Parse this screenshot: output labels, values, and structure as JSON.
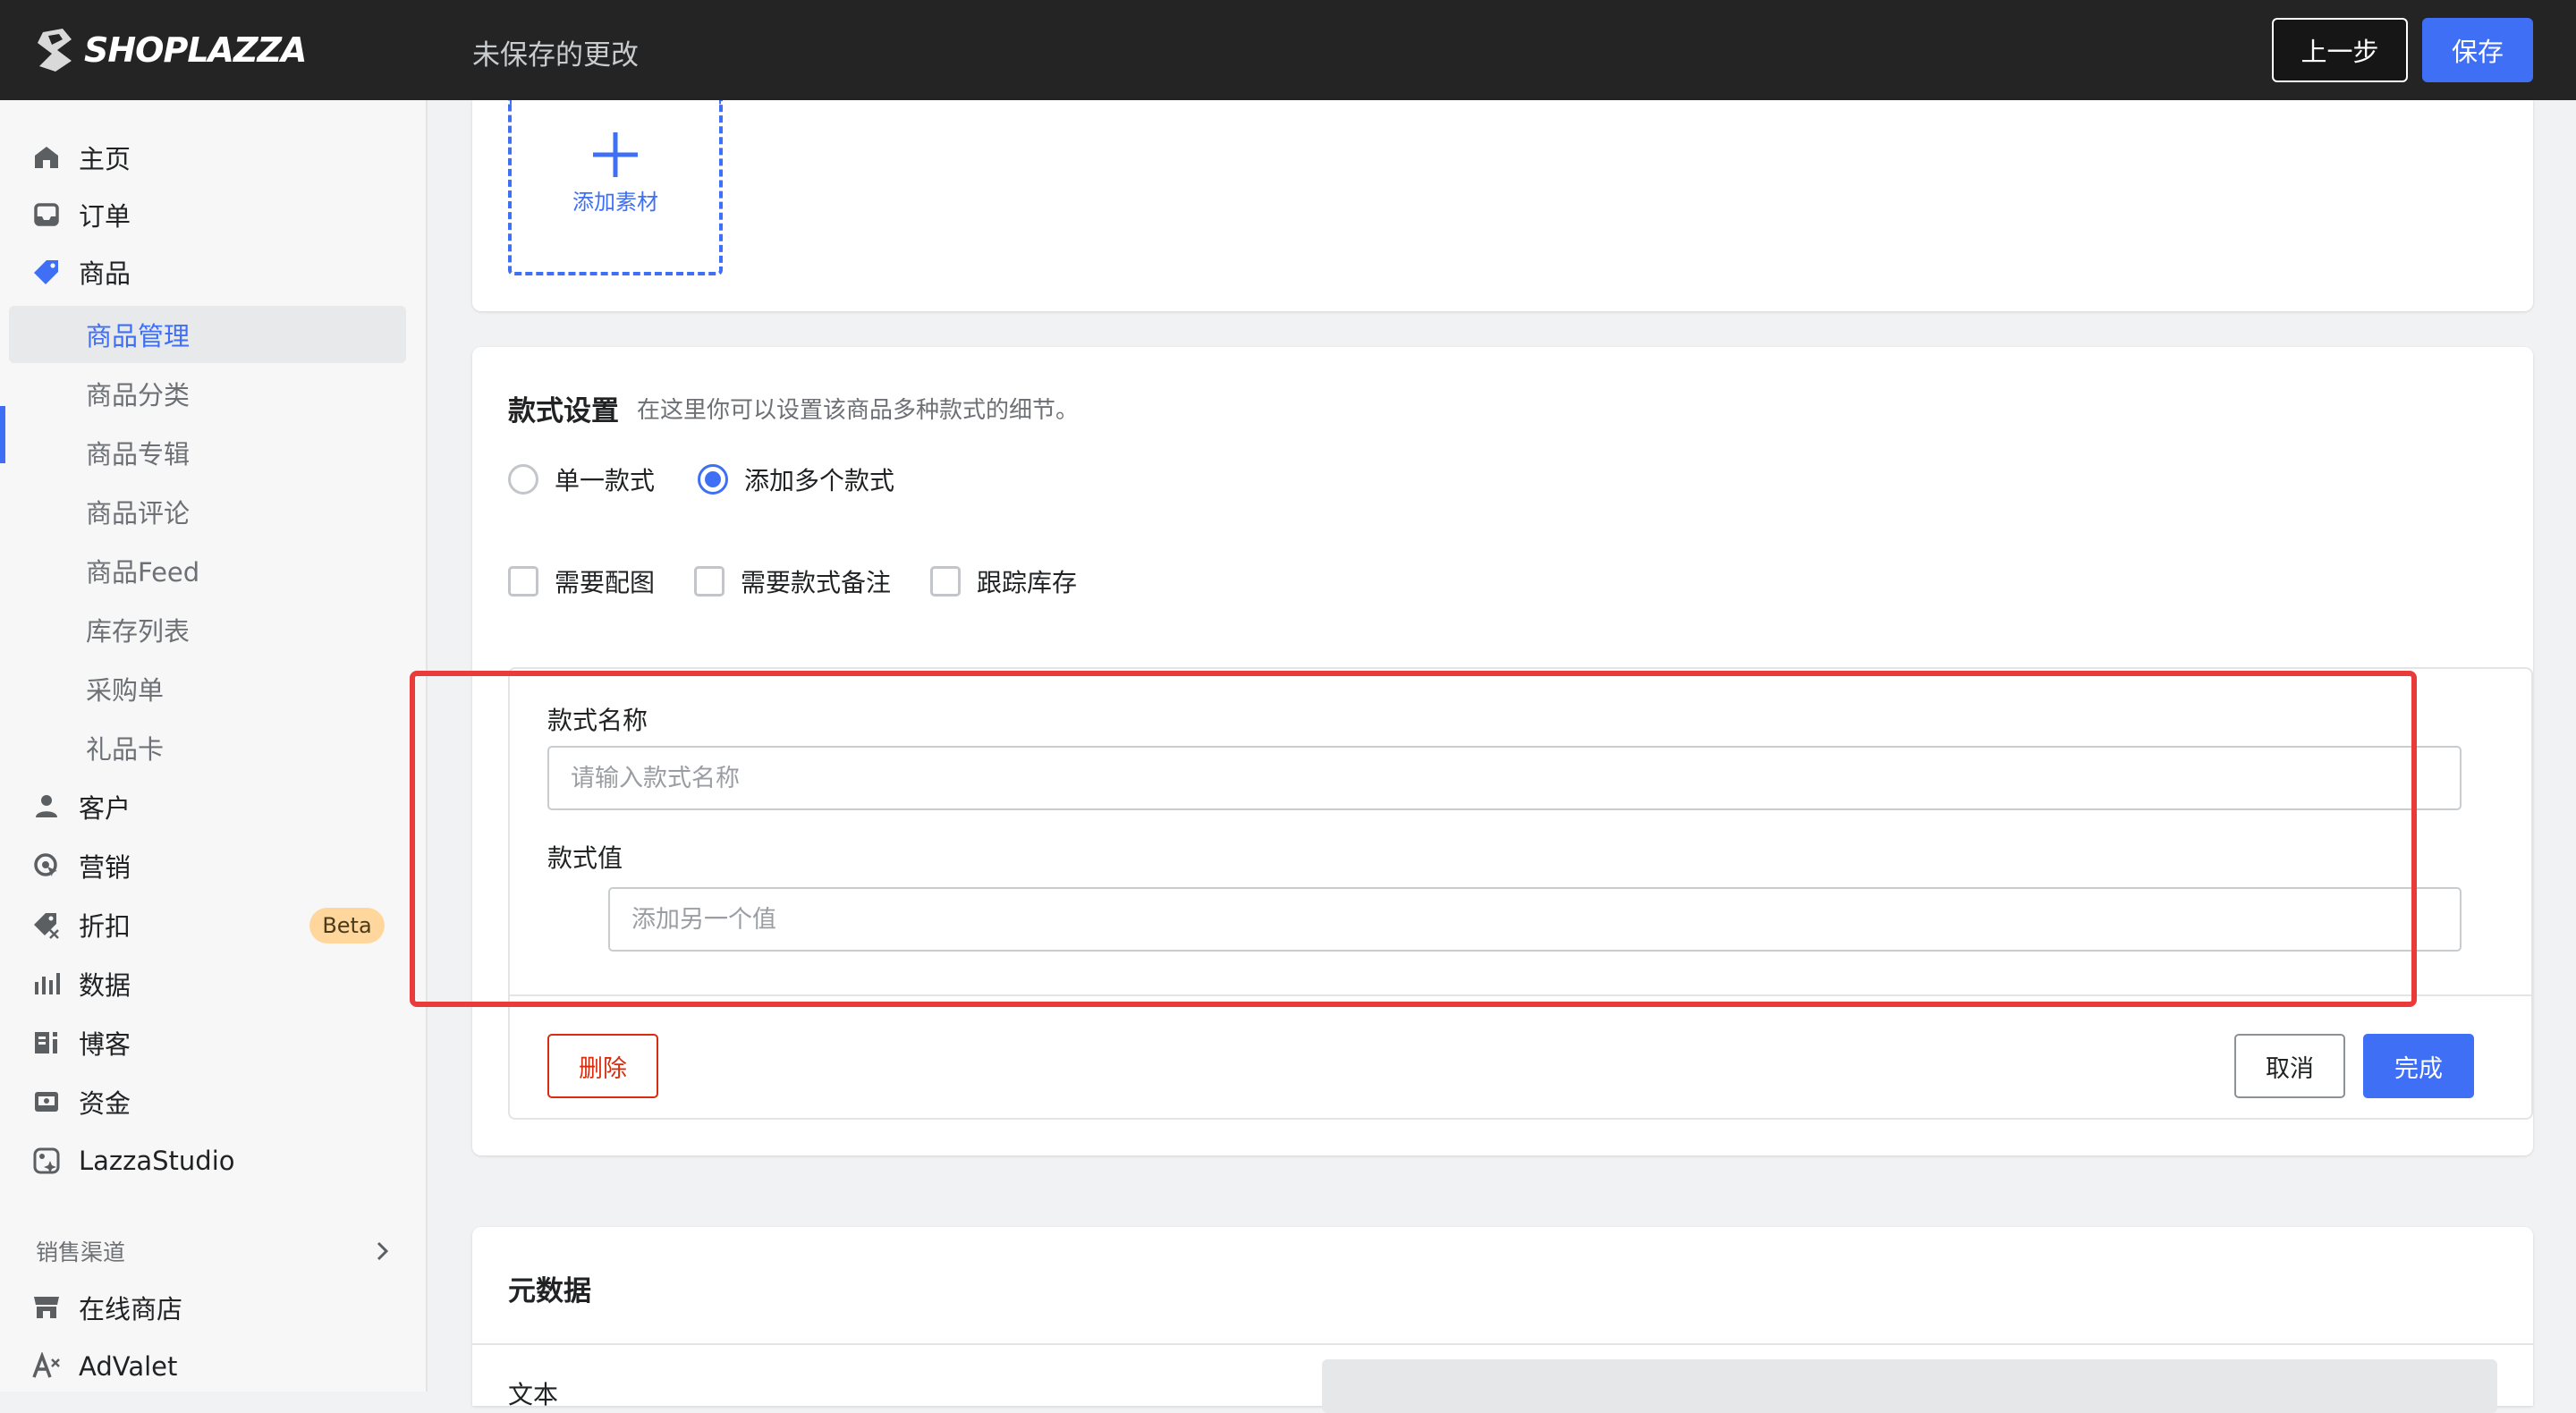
{
  "topbar": {
    "brand": "SHOPLAZZA",
    "status": "未保存的更改",
    "prev_label": "上一步",
    "save_label": "保存"
  },
  "sidebar": {
    "items": [
      {
        "label": "主页",
        "icon": "home-icon"
      },
      {
        "label": "订单",
        "icon": "inbox-icon"
      },
      {
        "label": "商品",
        "icon": "tag-icon"
      },
      {
        "label": "商品管理"
      },
      {
        "label": "商品分类"
      },
      {
        "label": "商品专辑"
      },
      {
        "label": "商品评论"
      },
      {
        "label": "商品Feed"
      },
      {
        "label": "库存列表"
      },
      {
        "label": "采购单"
      },
      {
        "label": "礼品卡"
      },
      {
        "label": "客户",
        "icon": "person-icon"
      },
      {
        "label": "营销",
        "icon": "target-icon"
      },
      {
        "label": "折扣",
        "icon": "discount-icon",
        "badge": "Beta"
      },
      {
        "label": "数据",
        "icon": "bar-chart-icon"
      },
      {
        "label": "博客",
        "icon": "blog-icon"
      },
      {
        "label": "资金",
        "icon": "wallet-icon"
      },
      {
        "label": "LazzaStudio",
        "icon": "studio-icon"
      }
    ],
    "channels_heading": "销售渠道",
    "channels": [
      {
        "label": "在线商店",
        "icon": "store-icon"
      },
      {
        "label": "AdValet",
        "icon": "advalet-icon"
      }
    ]
  },
  "media": {
    "add_label": "添加素材"
  },
  "variants": {
    "title": "款式设置",
    "description": "在这里你可以设置该商品多种款式的细节。",
    "radio_single": "单一款式",
    "radio_multi": "添加多个款式",
    "check_image": "需要配图",
    "check_note": "需要款式备注",
    "check_stock": "跟踪库存",
    "name_label": "款式名称",
    "name_placeholder": "请输入款式名称",
    "value_label": "款式值",
    "value_placeholder": "添加另一个值",
    "delete_label": "删除",
    "cancel_label": "取消",
    "done_label": "完成"
  },
  "metadata": {
    "title": "元数据",
    "text_label": "文本"
  },
  "colors": {
    "accent": "#3f6ff5",
    "danger": "#d72c0d",
    "highlight": "#ea3b3b",
    "topbar": "#242424"
  }
}
